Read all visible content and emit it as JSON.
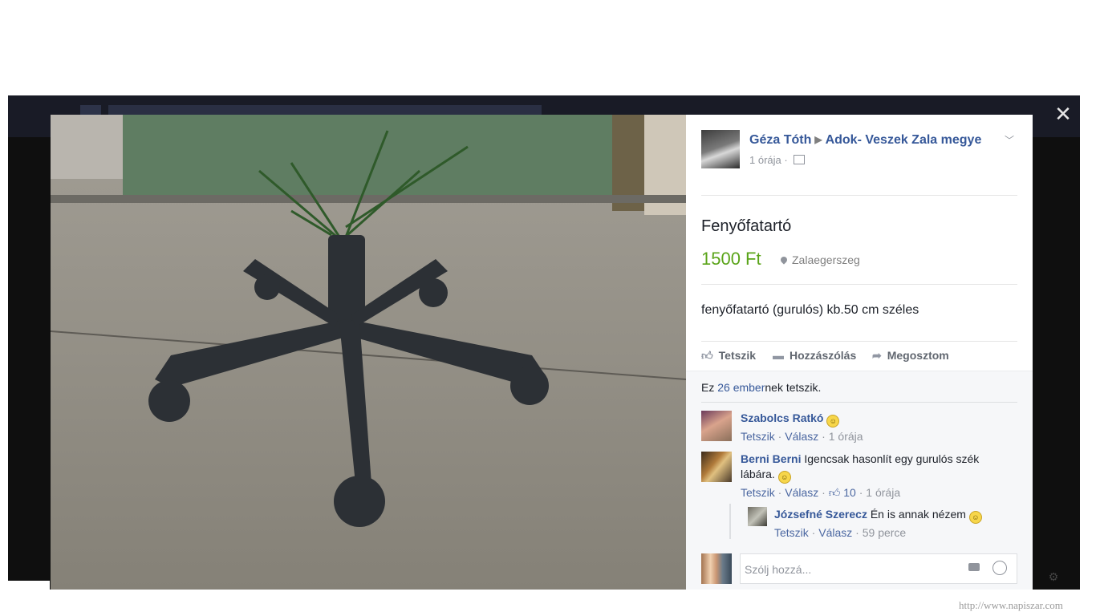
{
  "post": {
    "author": "Géza Tóth",
    "group": "Adok- Veszek Zala megye",
    "time": "1 órája",
    "item_title": "Fenyőfatartó",
    "price": "1500 Ft",
    "location": "Zalaegerszeg",
    "description": "fenyőfatartó (gurulós) kb.50 cm széles"
  },
  "actions": {
    "like": "Tetszik",
    "comment": "Hozzászólás",
    "share": "Megosztom"
  },
  "likes": {
    "prefix": "Ez ",
    "link": "26 ember",
    "suffix": "nek tetszik."
  },
  "comments": [
    {
      "name": "Szabolcs Ratkó",
      "text": "",
      "like": "Tetszik",
      "reply": "Válasz",
      "time": "1 órája",
      "likes": ""
    },
    {
      "name": "Berni Berni",
      "text": "Igencsak hasonlít egy gurulós szék lábára.",
      "like": "Tetszik",
      "reply": "Válasz",
      "time": "1 órája",
      "likes": "10"
    }
  ],
  "reply": {
    "name": "Józsefné Szerecz",
    "text": "Én is annak nézem",
    "like": "Tetszik",
    "reply": "Válasz",
    "time": "59 perce"
  },
  "composer": {
    "placeholder": "Szólj hozzá..."
  },
  "watermark": "http://www.napiszar.com",
  "icons": {
    "close": "close-icon",
    "like": "thumbs-up-icon",
    "comment": "comment-icon",
    "share": "share-arrow-icon",
    "camera": "camera-icon",
    "emoji": "emoji-icon",
    "location": "location-pin-icon"
  },
  "colors": {
    "link": "#365899",
    "price": "#5aa419",
    "backdrop": "#0f0f0f"
  }
}
